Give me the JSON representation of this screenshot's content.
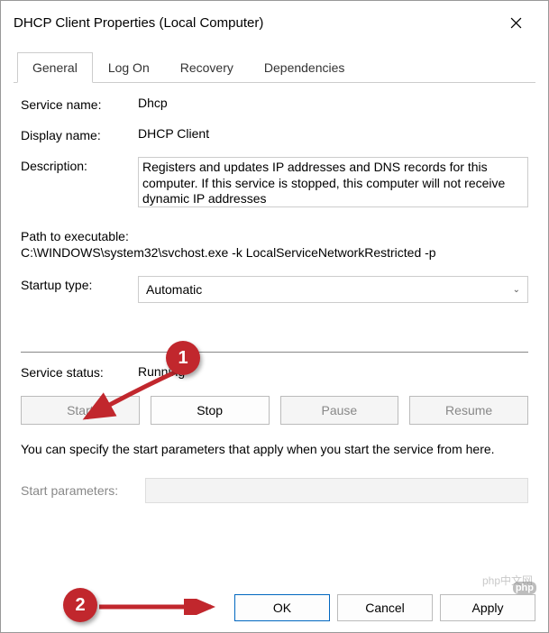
{
  "window": {
    "title": "DHCP Client Properties (Local Computer)"
  },
  "tabs": {
    "items": [
      "General",
      "Log On",
      "Recovery",
      "Dependencies"
    ],
    "active": 0
  },
  "general": {
    "service_name_label": "Service name:",
    "service_name_value": "Dhcp",
    "display_name_label": "Display name:",
    "display_name_value": "DHCP Client",
    "description_label": "Description:",
    "description_value": "Registers and updates IP addresses and DNS records for this computer. If this service is stopped, this computer will not receive dynamic IP addresses",
    "path_label": "Path to executable:",
    "path_value": "C:\\WINDOWS\\system32\\svchost.exe -k LocalServiceNetworkRestricted -p",
    "startup_type_label": "Startup type:",
    "startup_type_value": "Automatic",
    "status_label": "Service status:",
    "status_value": "Running",
    "hint": "You can specify the start parameters that apply when you start the service from here.",
    "start_params_label": "Start parameters:",
    "start_params_value": "",
    "buttons": {
      "start": "Start",
      "stop": "Stop",
      "pause": "Pause",
      "resume": "Resume"
    }
  },
  "footer": {
    "ok": "OK",
    "cancel": "Cancel",
    "apply": "Apply"
  },
  "callouts": {
    "one": "1",
    "two": "2"
  },
  "watermark": "php中文网",
  "php_badge": "php"
}
